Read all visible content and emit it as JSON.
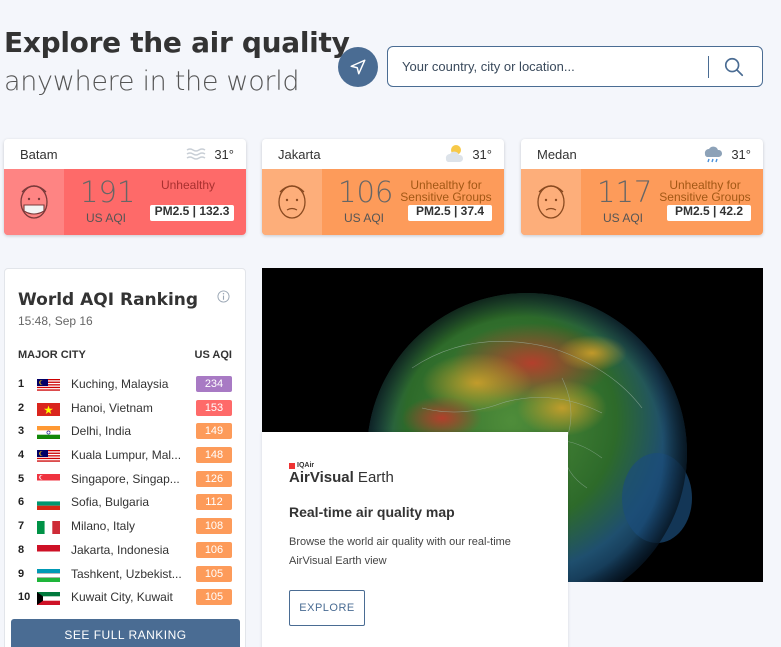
{
  "hero": {
    "title": "Explore the air quality",
    "subtitle": "anywhere in the world"
  },
  "search": {
    "placeholder": "Your country, city or location..."
  },
  "cities": [
    {
      "name": "Batam",
      "temp": "31°",
      "weather": "haze",
      "aqi": "191",
      "unit": "US AQI",
      "status": "Unhealthy",
      "pm": "PM2.5 | 132.3",
      "color": "#fe6a69"
    },
    {
      "name": "Jakarta",
      "temp": "31°",
      "weather": "partly-cloudy",
      "aqi": "106",
      "unit": "US AQI",
      "status": "Unhealthy for Sensitive Groups",
      "pm": "PM2.5 | 37.4",
      "color": "#fd9b5a"
    },
    {
      "name": "Medan",
      "temp": "31°",
      "weather": "rain",
      "aqi": "117",
      "unit": "US AQI",
      "status": "Unhealthy for Sensitive Groups",
      "pm": "PM2.5 | 42.2",
      "color": "#fd9b5a"
    }
  ],
  "ranking": {
    "title": "World AQI Ranking",
    "time": "15:48, Sep 16",
    "col_city": "MAJOR CITY",
    "col_aqi": "US AQI",
    "see_full": "SEE FULL RANKING",
    "rows": [
      {
        "rank": "1",
        "city": "Kuching, Malaysia",
        "aqi": "234",
        "flag": "malaysia",
        "color": "#a87ac4"
      },
      {
        "rank": "2",
        "city": "Hanoi, Vietnam",
        "aqi": "153",
        "flag": "vietnam",
        "color": "#fe6a69"
      },
      {
        "rank": "3",
        "city": "Delhi, India",
        "aqi": "149",
        "flag": "india",
        "color": "#fd9b5a"
      },
      {
        "rank": "4",
        "city": "Kuala Lumpur, Mal...",
        "aqi": "148",
        "flag": "malaysia",
        "color": "#fd9b5a"
      },
      {
        "rank": "5",
        "city": "Singapore, Singap...",
        "aqi": "126",
        "flag": "singapore",
        "color": "#fd9b5a"
      },
      {
        "rank": "6",
        "city": "Sofia, Bulgaria",
        "aqi": "112",
        "flag": "bulgaria",
        "color": "#fd9b5a"
      },
      {
        "rank": "7",
        "city": "Milano, Italy",
        "aqi": "108",
        "flag": "italy",
        "color": "#fd9b5a"
      },
      {
        "rank": "8",
        "city": "Jakarta, Indonesia",
        "aqi": "106",
        "flag": "indonesia",
        "color": "#fd9b5a"
      },
      {
        "rank": "9",
        "city": "Tashkent, Uzbekist...",
        "aqi": "105",
        "flag": "uzbekistan",
        "color": "#fd9b5a"
      },
      {
        "rank": "10",
        "city": "Kuwait City, Kuwait",
        "aqi": "105",
        "flag": "kuwait",
        "color": "#fd9b5a"
      }
    ]
  },
  "earth": {
    "brand_small": "IQAir",
    "brand_bold": "AirVisual",
    "brand_light": " Earth",
    "title": "Real-time air quality map",
    "desc": "Browse the world air quality with our real-time AirVisual Earth view",
    "explore": "EXPLORE"
  }
}
